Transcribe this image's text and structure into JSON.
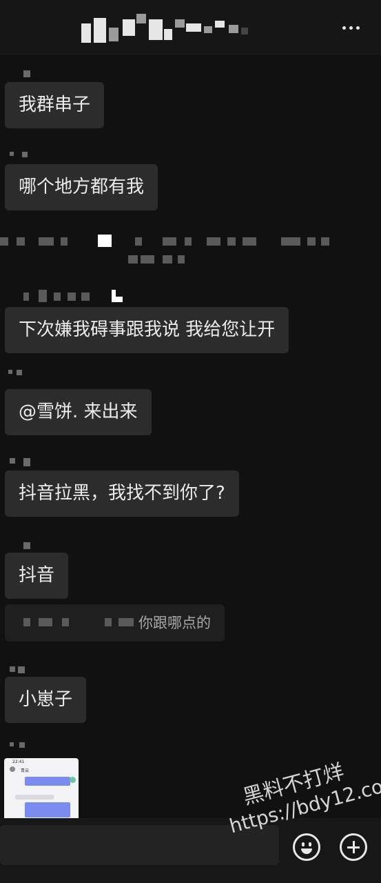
{
  "header": {
    "title": "",
    "more_icon": "more-dots-icon"
  },
  "messages": [
    {
      "text": "我群串子"
    },
    {
      "text": "哪个地方都有我"
    },
    {
      "text": "下次嫌我碍事跟我说 我给您让开"
    },
    {
      "text": "@雪饼. 来出来"
    },
    {
      "text": "抖音拉黑，我找不到你了?"
    },
    {
      "text": "抖音"
    },
    {
      "text": "你跟哪点的"
    },
    {
      "text": "小崽子"
    }
  ],
  "thumbnail": {
    "time": "22:41",
    "name": "青云"
  },
  "input_bar": {
    "emoji_icon": "emoji-icon",
    "plus_icon": "plus-icon"
  },
  "watermark": {
    "line1": "黑料不打烊",
    "line2": "https://bdy12.co"
  },
  "colors": {
    "background": "#111111",
    "bubble": "#2c2c2c",
    "text": "#ececec"
  }
}
